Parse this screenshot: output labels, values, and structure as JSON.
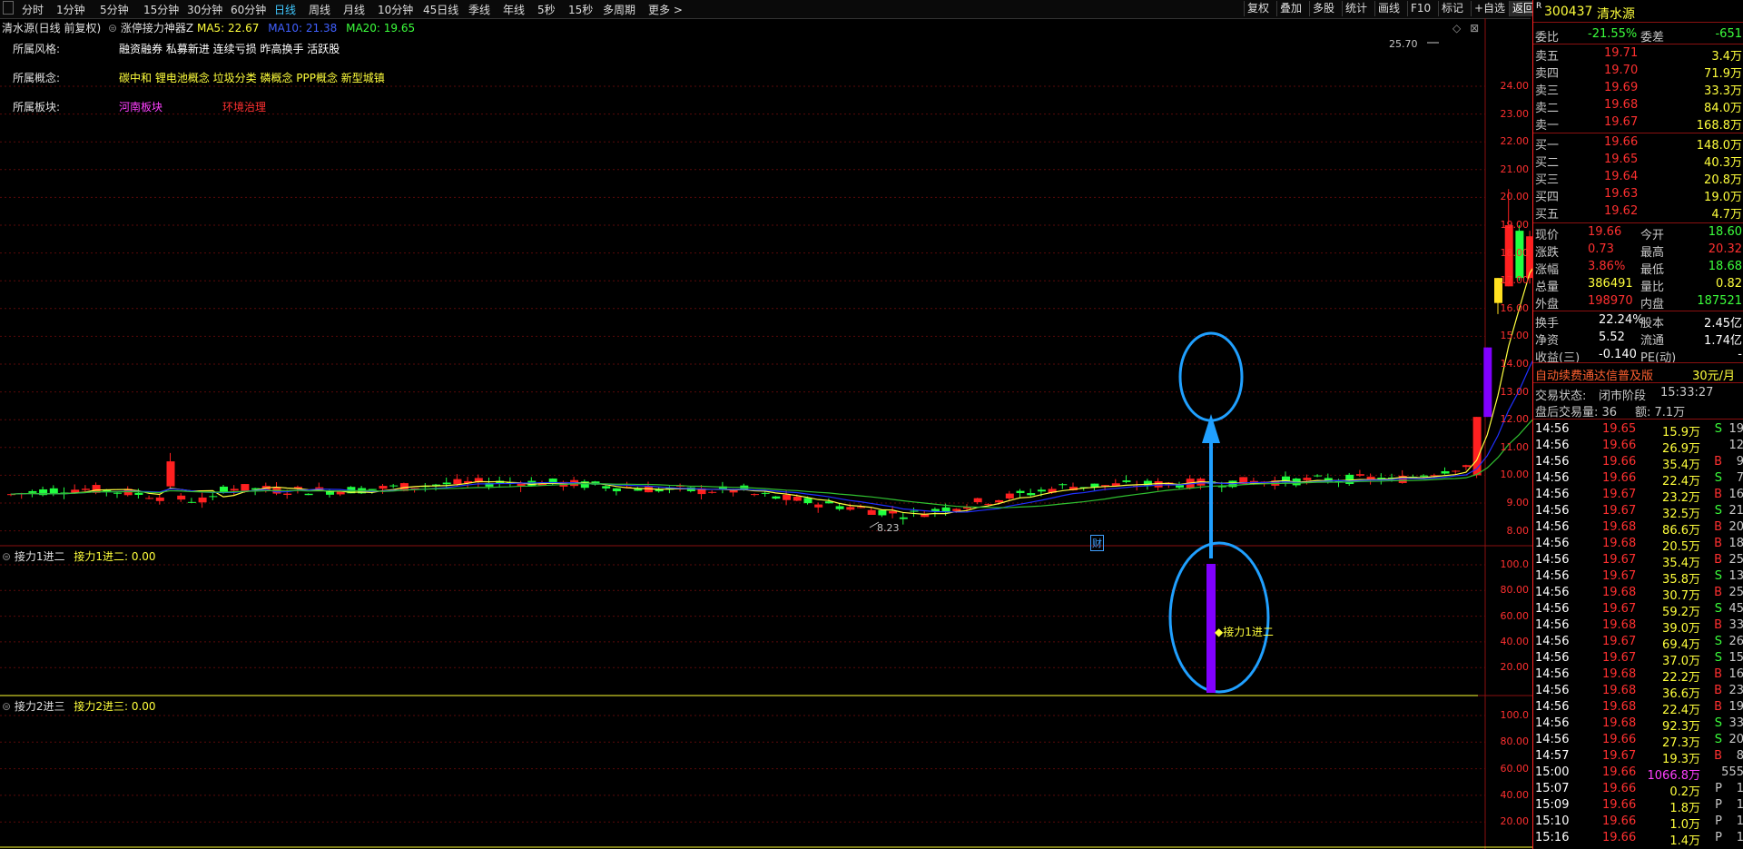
{
  "toolbar": {
    "periods": [
      "分时",
      "1分钟",
      "5分钟",
      "15分钟",
      "30分钟",
      "60分钟",
      "日线",
      "周线",
      "月线",
      "10分钟",
      "45日线",
      "季线",
      "年线",
      "5秒",
      "15秒",
      "多周期",
      "更多 >"
    ],
    "active_period": "日线",
    "right_buttons": [
      "复权",
      "叠加",
      "多股",
      "统计",
      "画线",
      "F10",
      "标记",
      "+自选",
      "返回"
    ]
  },
  "chart_header": {
    "title": "清水源(日线 前复权)",
    "indicator": "涨停接力神器Z",
    "ma5": "MA5: 22.67",
    "ma10": "MA10: 21.38",
    "ma20": "MA20: 19.65"
  },
  "info": {
    "style_label": "所属风格:",
    "style_value": "融资融券 私募新进 连续亏损 昨高换手 活跃股",
    "concept_label": "所属概念:",
    "concept_value": "碳中和 锂电池概念 垃圾分类 磷概念 PPP概念 新型城镇",
    "sector_label": "所属板块:",
    "sector_value1": "河南板块",
    "sector_value2": "环境治理"
  },
  "price_axis": [
    "24.00",
    "23.00",
    "22.00",
    "21.00",
    "20.00",
    "19.00",
    "18.00",
    "17.00",
    "16.00",
    "15.00",
    "14.00",
    "13.00",
    "12.00",
    "11.00",
    "10.00",
    "9.00",
    "8.00"
  ],
  "annotations": {
    "high": "25.70",
    "low": "8.23",
    "cai": "财",
    "marker_label": "接力1进二"
  },
  "panel1": {
    "title": "接力1进二",
    "value": "接力1进二: 0.00",
    "axis": [
      "100.0",
      "80.00",
      "60.00",
      "40.00",
      "20.00"
    ]
  },
  "panel2": {
    "title": "接力2进三",
    "value": "接力2进三: 0.00",
    "axis": [
      "100.0",
      "80.00",
      "60.00",
      "40.00",
      "20.00"
    ]
  },
  "quote": {
    "code": "300437",
    "name": "清水源",
    "weibi_label": "委比",
    "weibi": "-21.55%",
    "weicha_label": "委差",
    "weicha": "-651",
    "asks": [
      {
        "label": "卖五",
        "price": "19.71",
        "vol": "3.4万"
      },
      {
        "label": "卖四",
        "price": "19.70",
        "vol": "71.9万"
      },
      {
        "label": "卖三",
        "price": "19.69",
        "vol": "33.3万"
      },
      {
        "label": "卖二",
        "price": "19.68",
        "vol": "84.0万"
      },
      {
        "label": "卖一",
        "price": "19.67",
        "vol": "168.8万"
      }
    ],
    "bids": [
      {
        "label": "买一",
        "price": "19.66",
        "vol": "148.0万"
      },
      {
        "label": "买二",
        "price": "19.65",
        "vol": "40.3万"
      },
      {
        "label": "买三",
        "price": "19.64",
        "vol": "20.8万"
      },
      {
        "label": "买四",
        "price": "19.63",
        "vol": "19.0万"
      },
      {
        "label": "买五",
        "price": "19.62",
        "vol": "4.7万"
      }
    ],
    "stats": [
      {
        "l1": "现价",
        "v1": "19.66",
        "l2": "今开",
        "v2": "18.60"
      },
      {
        "l1": "涨跌",
        "v1": "0.73",
        "l2": "最高",
        "v2": "20.32"
      },
      {
        "l1": "涨幅",
        "v1": "3.86%",
        "l2": "最低",
        "v2": "18.68"
      },
      {
        "l1": "总量",
        "v1": "386491",
        "l2": "量比",
        "v2": "0.82"
      },
      {
        "l1": "外盘",
        "v1": "198970",
        "l2": "内盘",
        "v2": "187521"
      }
    ],
    "stats2": [
      {
        "l1": "换手",
        "v1": "22.24%",
        "l2": "股本",
        "v2": "2.45亿"
      },
      {
        "l1": "净资",
        "v1": "5.52",
        "l2": "流通",
        "v2": "1.74亿"
      },
      {
        "l1": "收益(三)",
        "v1": "-0.140",
        "l2": "PE(动)",
        "v2": "-"
      }
    ],
    "ad": "自动续费通达信普及版",
    "ad_price": "30元/月",
    "trade_status_label": "交易状态:",
    "trade_status": "闭市阶段",
    "trade_time": "15:33:27",
    "after_hours": "盘后交易量: 36",
    "after_amount": "额: 7.1万"
  },
  "ticks": [
    {
      "t": "14:56",
      "p": "19.65",
      "v": "15.9万",
      "bs": "S",
      "n": "19"
    },
    {
      "t": "14:56",
      "p": "19.66",
      "v": "26.9万",
      "bs": "",
      "n": "12"
    },
    {
      "t": "14:56",
      "p": "19.66",
      "v": "35.4万",
      "bs": "B",
      "n": "9"
    },
    {
      "t": "14:56",
      "p": "19.66",
      "v": "22.4万",
      "bs": "S",
      "n": "7"
    },
    {
      "t": "14:56",
      "p": "19.67",
      "v": "23.2万",
      "bs": "B",
      "n": "16"
    },
    {
      "t": "14:56",
      "p": "19.67",
      "v": "32.5万",
      "bs": "S",
      "n": "21"
    },
    {
      "t": "14:56",
      "p": "19.68",
      "v": "86.6万",
      "bs": "B",
      "n": "20"
    },
    {
      "t": "14:56",
      "p": "19.68",
      "v": "20.5万",
      "bs": "B",
      "n": "18"
    },
    {
      "t": "14:56",
      "p": "19.67",
      "v": "35.4万",
      "bs": "B",
      "n": "25"
    },
    {
      "t": "14:56",
      "p": "19.67",
      "v": "35.8万",
      "bs": "S",
      "n": "13"
    },
    {
      "t": "14:56",
      "p": "19.68",
      "v": "30.7万",
      "bs": "B",
      "n": "25"
    },
    {
      "t": "14:56",
      "p": "19.67",
      "v": "59.2万",
      "bs": "S",
      "n": "45"
    },
    {
      "t": "14:56",
      "p": "19.68",
      "v": "39.0万",
      "bs": "B",
      "n": "33"
    },
    {
      "t": "14:56",
      "p": "19.67",
      "v": "69.4万",
      "bs": "S",
      "n": "26"
    },
    {
      "t": "14:56",
      "p": "19.67",
      "v": "37.0万",
      "bs": "S",
      "n": "15"
    },
    {
      "t": "14:56",
      "p": "19.68",
      "v": "22.2万",
      "bs": "B",
      "n": "16"
    },
    {
      "t": "14:56",
      "p": "19.68",
      "v": "36.6万",
      "bs": "B",
      "n": "23"
    },
    {
      "t": "14:56",
      "p": "19.68",
      "v": "22.4万",
      "bs": "B",
      "n": "19"
    },
    {
      "t": "14:56",
      "p": "19.68",
      "v": "92.3万",
      "bs": "S",
      "n": "33"
    },
    {
      "t": "14:56",
      "p": "19.66",
      "v": "27.3万",
      "bs": "S",
      "n": "20"
    },
    {
      "t": "14:57",
      "p": "19.67",
      "v": "19.3万",
      "bs": "B",
      "n": "8"
    },
    {
      "t": "15:00",
      "p": "19.66",
      "v": "1066.8万",
      "bs": "",
      "n": "555"
    },
    {
      "t": "15:07",
      "p": "19.66",
      "v": "0.2万",
      "bs": "P",
      "n": "1"
    },
    {
      "t": "15:09",
      "p": "19.66",
      "v": "1.8万",
      "bs": "P",
      "n": "1"
    },
    {
      "t": "15:10",
      "p": "19.66",
      "v": "1.0万",
      "bs": "P",
      "n": "1"
    },
    {
      "t": "15:16",
      "p": "19.66",
      "v": "1.4万",
      "bs": "P",
      "n": "1"
    }
  ],
  "colors": {
    "up": "#ff2020",
    "down": "#20ff40",
    "ma5": "#ffff40",
    "ma10": "#2030ff",
    "ma20": "#30c030",
    "purple": "#8000ff",
    "circle": "#20a0ff"
  }
}
